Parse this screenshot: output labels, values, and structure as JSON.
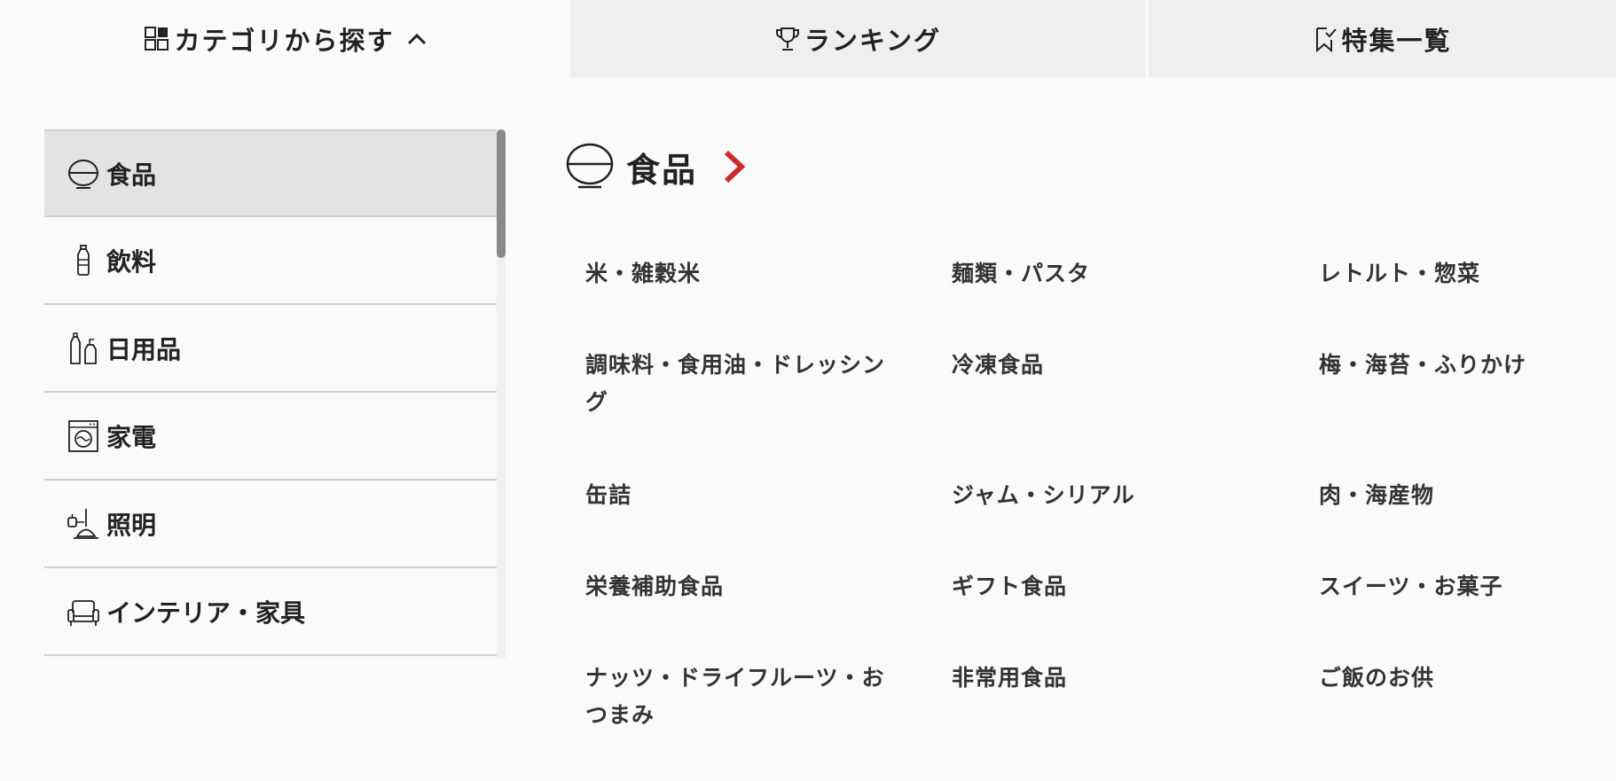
{
  "tabs": {
    "category": {
      "label": "カテゴリから探す",
      "icon": "category-grid-icon"
    },
    "ranking": {
      "label": "ランキング",
      "icon": "trophy-icon"
    },
    "features": {
      "label": "特集一覧",
      "icon": "bookmark-icon"
    }
  },
  "sidebar": {
    "items": [
      {
        "label": "食品",
        "icon": "rice-bowl-icon",
        "active": true
      },
      {
        "label": "飲料",
        "icon": "bottle-icon"
      },
      {
        "label": "日用品",
        "icon": "detergent-bottles-icon"
      },
      {
        "label": "家電",
        "icon": "washing-machine-icon"
      },
      {
        "label": "照明",
        "icon": "pendant-lamp-icon"
      },
      {
        "label": "インテリア・家具",
        "icon": "sofa-icon"
      }
    ]
  },
  "main": {
    "heading": "食品",
    "heading_icon": "rice-bowl-icon",
    "subcategories": [
      "米・雑穀米",
      "麺類・パスタ",
      "レトルト・惣菜",
      "調味料・食用油・ドレッシング",
      "冷凍食品",
      "梅・海苔・ふりかけ",
      "缶詰",
      "ジャム・シリアル",
      "肉・海産物",
      "栄養補助食品",
      "ギフト食品",
      "スイーツ・お菓子",
      "ナッツ・ドライフルーツ・おつまみ",
      "非常用食品",
      "ご飯のお供"
    ]
  },
  "colors": {
    "accent": "#cc2b2b",
    "tab_bg": "#efefef",
    "active_bg": "#e3e3e3",
    "page_bg": "#fafafa"
  }
}
